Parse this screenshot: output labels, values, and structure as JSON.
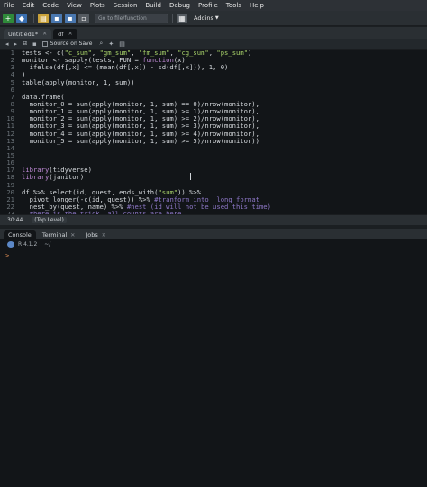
{
  "menubar": {
    "items": [
      "File",
      "Edit",
      "Code",
      "View",
      "Plots",
      "Session",
      "Build",
      "Debug",
      "Profile",
      "Tools",
      "Help"
    ]
  },
  "toolbar": {
    "goto_placeholder": "Go to file/function",
    "addins_label": "Addins"
  },
  "editor": {
    "tabs": [
      {
        "label": "Untitled1*",
        "active": false
      },
      {
        "label": "df",
        "active": true
      }
    ],
    "source_on_save_label": "Source on Save",
    "lines": [
      {
        "n": "1",
        "parts": [
          [
            "txt",
            "tests <- c("
          ],
          [
            "str",
            "\"c_sum\""
          ],
          [
            "txt",
            ", "
          ],
          [
            "str",
            "\"gm_sum\""
          ],
          [
            "txt",
            ", "
          ],
          [
            "str",
            "\"fm_sum\""
          ],
          [
            "txt",
            ", "
          ],
          [
            "str",
            "\"cg_sum\""
          ],
          [
            "txt",
            ", "
          ],
          [
            "str",
            "\"ps_sum\""
          ],
          [
            "txt",
            ")"
          ]
        ]
      },
      {
        "n": "2",
        "parts": [
          [
            "txt",
            "monitor <- sapply(tests, FUN = "
          ],
          [
            "kw",
            "function"
          ],
          [
            "txt",
            "(x)"
          ]
        ]
      },
      {
        "n": "3",
        "parts": [
          [
            "txt",
            "  ifelse(df[,x] <= (mean(df[,x]) - sd(df[,x])), 1, 0)"
          ]
        ]
      },
      {
        "n": "4",
        "parts": [
          [
            "txt",
            ")"
          ]
        ]
      },
      {
        "n": "5",
        "parts": [
          [
            "txt",
            "table(apply(monitor, 1, sum))"
          ]
        ]
      },
      {
        "n": "6",
        "parts": [
          [
            "txt",
            ""
          ]
        ]
      },
      {
        "n": "7",
        "parts": [
          [
            "txt",
            "data.frame("
          ]
        ]
      },
      {
        "n": "8",
        "parts": [
          [
            "txt",
            "  monitor_0 = sum(apply(monitor, 1, sum) == 0)/nrow(monitor),"
          ]
        ]
      },
      {
        "n": "9",
        "parts": [
          [
            "txt",
            "  monitor_1 = sum(apply(monitor, 1, sum) >= 1)/nrow(monitor),"
          ]
        ]
      },
      {
        "n": "10",
        "parts": [
          [
            "txt",
            "  monitor_2 = sum(apply(monitor, 1, sum) >= 2)/nrow(monitor),"
          ]
        ]
      },
      {
        "n": "11",
        "parts": [
          [
            "txt",
            "  monitor_3 = sum(apply(monitor, 1, sum) >= 3)/nrow(monitor),"
          ]
        ]
      },
      {
        "n": "12",
        "parts": [
          [
            "txt",
            "  monitor_4 = sum(apply(monitor, 1, sum) >= 4)/nrow(monitor),"
          ]
        ]
      },
      {
        "n": "13",
        "parts": [
          [
            "txt",
            "  monitor_5 = sum(apply(monitor, 1, sum) >= 5)/nrow(monitor))"
          ]
        ]
      },
      {
        "n": "14",
        "parts": [
          [
            "txt",
            ""
          ]
        ]
      },
      {
        "n": "15",
        "parts": [
          [
            "txt",
            ""
          ]
        ]
      },
      {
        "n": "16",
        "parts": [
          [
            "txt",
            ""
          ]
        ]
      },
      {
        "n": "17",
        "parts": [
          [
            "kw",
            "library"
          ],
          [
            "txt",
            "(tidyverse)"
          ]
        ]
      },
      {
        "n": "18",
        "parts": [
          [
            "kw",
            "library"
          ],
          [
            "txt",
            "(janitor)"
          ]
        ]
      },
      {
        "n": "19",
        "parts": [
          [
            "txt",
            ""
          ]
        ]
      },
      {
        "n": "20",
        "parts": [
          [
            "txt",
            "df %>% select(id, quest, ends_with("
          ],
          [
            "str",
            "\"sum\""
          ],
          [
            "txt",
            ")) %>%"
          ]
        ]
      },
      {
        "n": "21",
        "parts": [
          [
            "txt",
            "  pivot_longer(-c(id, quest)) %>% "
          ],
          [
            "cmt",
            "#tranform into  long format"
          ]
        ]
      },
      {
        "n": "22",
        "parts": [
          [
            "txt",
            "  nest_by(quest, name) %>% "
          ],
          [
            "cmt",
            "#nest (id will not be used this time)"
          ]
        ]
      },
      {
        "n": "23",
        "parts": [
          [
            "txt",
            "  "
          ],
          [
            "cmt",
            "#here is the trick. all counts are here"
          ]
        ]
      },
      {
        "n": "24",
        "parts": [
          [
            "txt",
            "  mutate("
          ]
        ]
      }
    ],
    "status_position": "30:44",
    "status_level": "(Top Level)"
  },
  "console": {
    "tabs": [
      {
        "label": "Console",
        "active": true
      },
      {
        "label": "Terminal",
        "active": false
      },
      {
        "label": "Jobs",
        "active": false
      }
    ],
    "r_version": "R 4.1.2",
    "working_dir": "~/",
    "prompt": ">"
  },
  "colors": {
    "string": "#a9d46a",
    "keyword": "#c08ad6",
    "comment": "#8e78c8",
    "prompt": "#e08f54",
    "background": "#121518"
  }
}
